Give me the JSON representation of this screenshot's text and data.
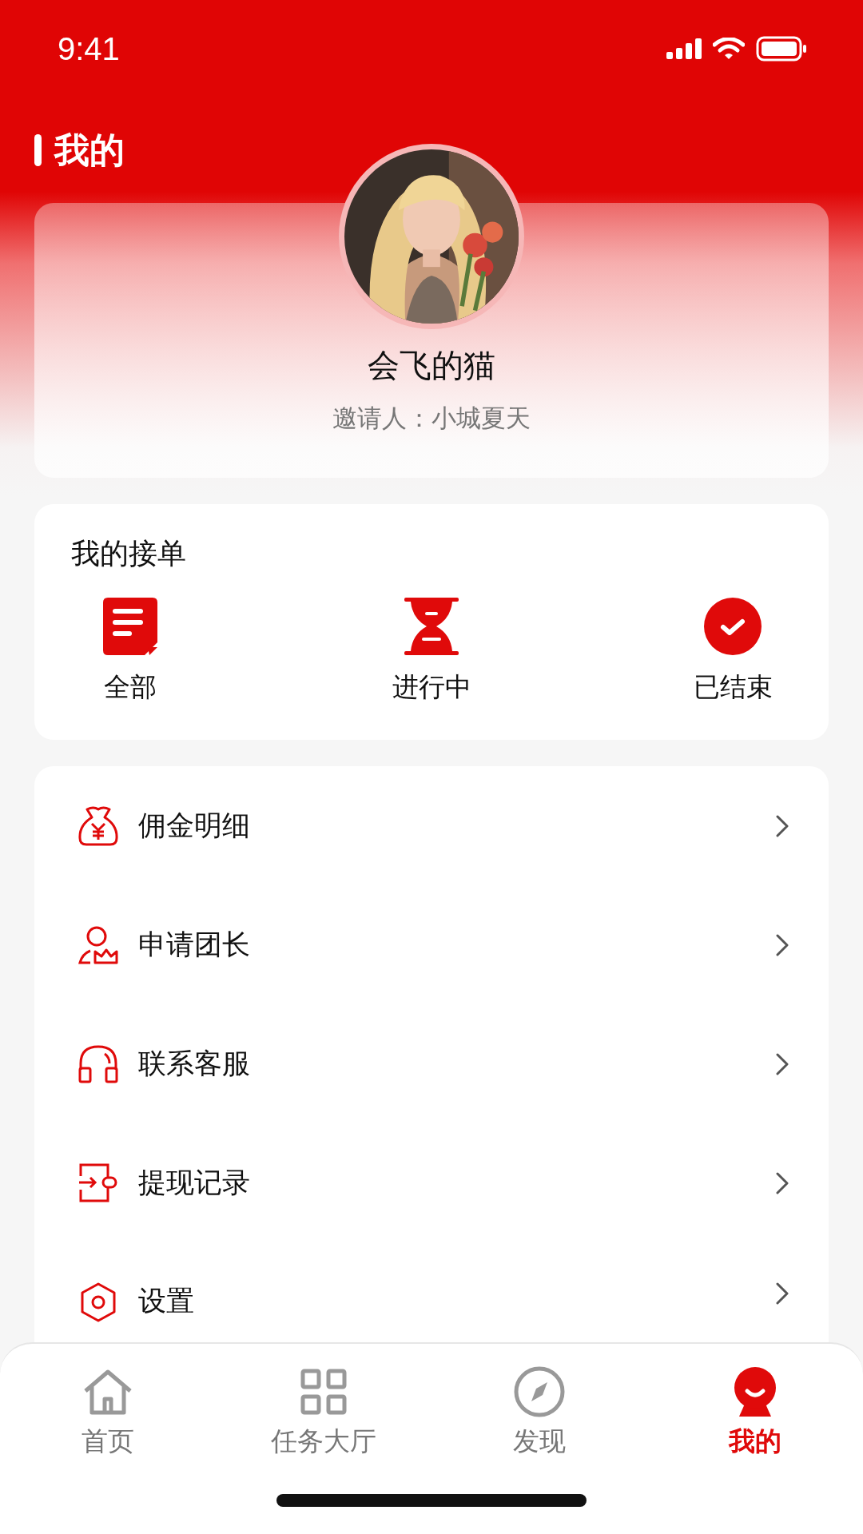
{
  "status_bar": {
    "time": "9:41"
  },
  "header": {
    "title": "我的"
  },
  "profile": {
    "name": "会飞的猫",
    "inviter": "邀请人：小城夏天"
  },
  "orders": {
    "title": "我的接单",
    "items": [
      {
        "kind": "all",
        "label": "全部"
      },
      {
        "kind": "progress",
        "label": "进行中"
      },
      {
        "kind": "done",
        "label": "已结束"
      }
    ]
  },
  "menu": [
    {
      "kind": "commission",
      "label": "佣金明细"
    },
    {
      "kind": "leader",
      "label": "申请团长"
    },
    {
      "kind": "service",
      "label": "联系客服"
    },
    {
      "kind": "withdraw",
      "label": "提现记录"
    },
    {
      "kind": "settings",
      "label": "设置"
    }
  ],
  "tab_bar": [
    {
      "kind": "home",
      "label": "首页",
      "selected": false
    },
    {
      "kind": "hall",
      "label": "任务大厅",
      "selected": false
    },
    {
      "kind": "discover",
      "label": "发现",
      "selected": false
    },
    {
      "kind": "mine",
      "label": "我的",
      "selected": true
    }
  ]
}
